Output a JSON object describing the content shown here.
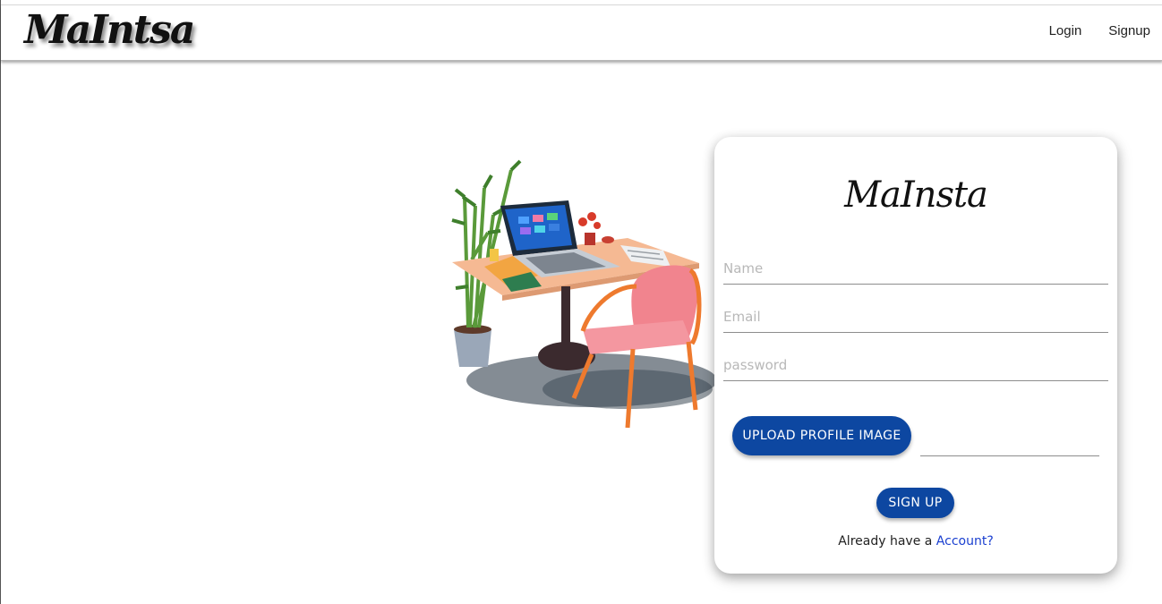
{
  "navbar": {
    "brand": "MaIntsa",
    "links": [
      {
        "label": "Login"
      },
      {
        "label": "Signup"
      }
    ]
  },
  "card": {
    "brand": "MaInsta",
    "name_placeholder": "Name",
    "email_placeholder": "Email",
    "password_placeholder": "password",
    "upload_label": "UPLOAD PROFILE IMAGE",
    "signup_label": "SIGN UP",
    "already_text": "Already have a",
    "account_link": "Account?"
  },
  "colors": {
    "primary_button": "#0d47a1",
    "link": "#1a3fd0"
  }
}
